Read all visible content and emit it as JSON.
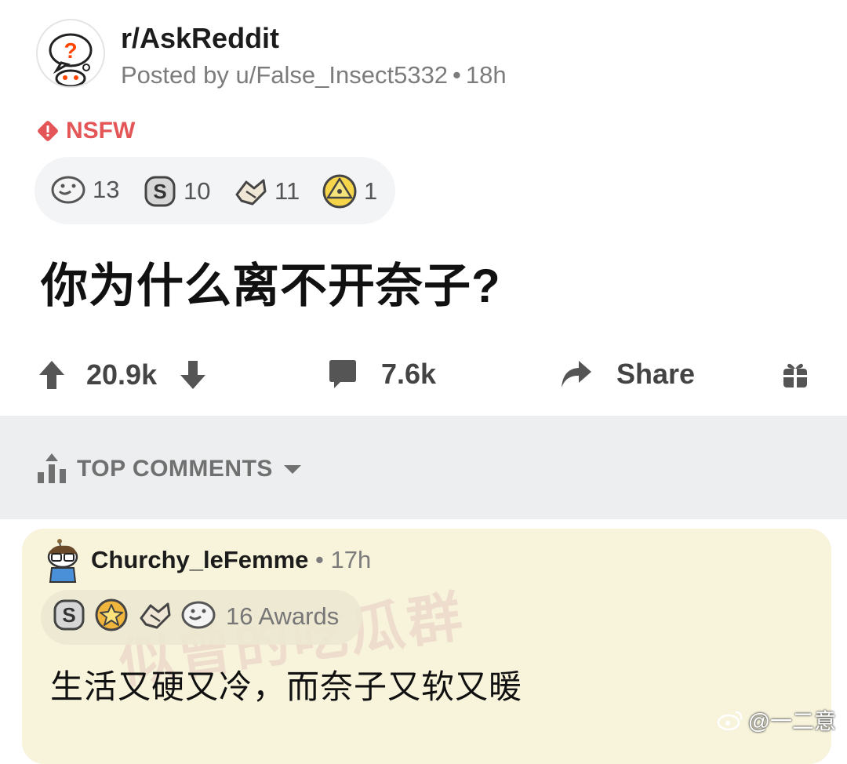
{
  "post": {
    "subreddit": "r/AskReddit",
    "posted_by": "Posted by u/False_Insect5332",
    "age": "18h",
    "nsfw_label": "NSFW",
    "awards": [
      {
        "icon": "helpful-award-icon",
        "count": "13"
      },
      {
        "icon": "silver-coin-award-icon",
        "count": "10"
      },
      {
        "icon": "wholesome-handshake-award-icon",
        "count": "11"
      },
      {
        "icon": "illuminati-award-icon",
        "count": "1"
      }
    ],
    "title": "你为什么离不开奈子?",
    "votes": "20.9k",
    "comments": "7.6k",
    "share_label": "Share"
  },
  "sort": {
    "label": "TOP COMMENTS"
  },
  "comment": {
    "author": "Churchy_leFemme",
    "age": "17h",
    "awards_label": "16 Awards",
    "body": "生活又硬又冷，而奈子又软又暖",
    "watermark": "似曾的吃瓜群"
  },
  "watermark_weibo": "@一二意",
  "colors": {
    "nsfw": "#e35557",
    "band": "#eceeef",
    "comment_bg": "#f8f4dc",
    "meta_text": "#7c7c7c"
  }
}
